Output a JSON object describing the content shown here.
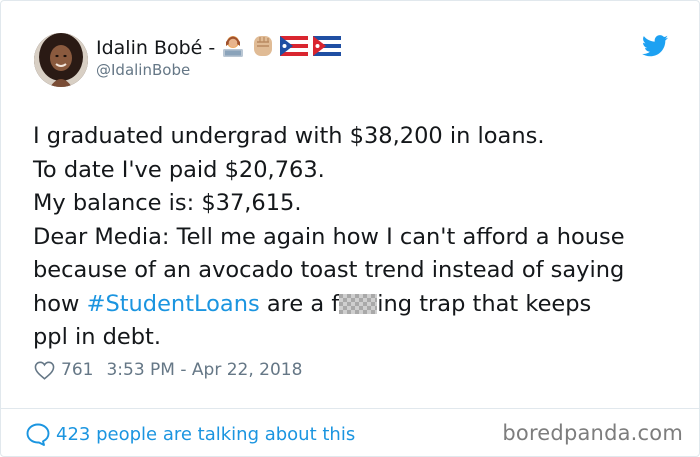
{
  "author": {
    "display_name": "Idalin Bobé",
    "name_separator": "-",
    "handle": "@IdalinBobe",
    "emojis": [
      "woman-technologist-emoji",
      "raised-fist-emoji",
      "puerto-rico-flag-emoji",
      "cuba-flag-emoji"
    ]
  },
  "tweet": {
    "lines": [
      "I graduated undergrad with $38,200 in loans.",
      "To date I've paid $20,763.",
      "My balance is: $37,615.",
      "Dear Media: Tell me again how I can't afford a house",
      "because of an avocado toast trend instead of saying"
    ],
    "line6_prefix": "how ",
    "hashtag": "#StudentLoans",
    "line6_middle": " are a f",
    "line6_suffix": "ing trap that keeps",
    "line7": "ppl in debt."
  },
  "meta": {
    "likes": "761",
    "timestamp": "3:53 PM - Apr 22, 2018"
  },
  "footer": {
    "conversation_text": "423 people are talking about this"
  },
  "watermark": "boredpanda.com",
  "colors": {
    "link_blue": "#1b95e0",
    "text": "#14171a",
    "muted": "#657786",
    "border": "#e1e8ed"
  }
}
